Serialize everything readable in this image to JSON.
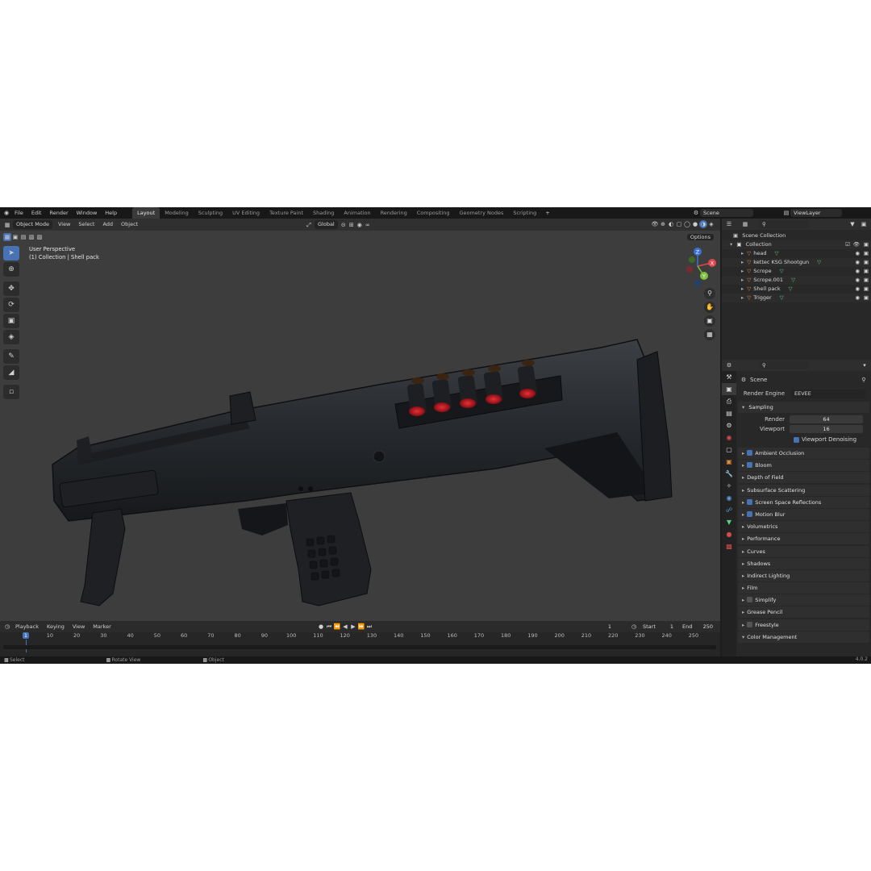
{
  "topbar": {
    "menus": [
      "File",
      "Edit",
      "Render",
      "Window",
      "Help"
    ],
    "workspaces": [
      "Layout",
      "Modeling",
      "Sculpting",
      "UV Editing",
      "Texture Paint",
      "Shading",
      "Animation",
      "Rendering",
      "Compositing",
      "Geometry Nodes",
      "Scripting"
    ],
    "active_workspace": "Layout",
    "add_tab": "+",
    "scene": "Scene",
    "view_layer": "ViewLayer"
  },
  "viewport_header": {
    "mode": "Object Mode",
    "menus": [
      "View",
      "Select",
      "Add",
      "Object"
    ],
    "orientation": "Global",
    "options": "Options"
  },
  "viewport": {
    "perspective": "User Perspective",
    "context": "(1) Collection | Shell pack",
    "gizmo_axes": [
      "Z",
      "Y",
      "X"
    ],
    "model_name": "kettec KSG Shootgun"
  },
  "timeline": {
    "menus": [
      "Playback",
      "Keying",
      "View",
      "Marker"
    ],
    "current_frame": "1",
    "start_label": "Start",
    "start": "1",
    "end_label": "End",
    "end": "250",
    "ticks": [
      "1",
      "10",
      "20",
      "30",
      "40",
      "50",
      "60",
      "70",
      "80",
      "90",
      "100",
      "110",
      "120",
      "130",
      "140",
      "150",
      "160",
      "170",
      "180",
      "190",
      "200",
      "210",
      "220",
      "230",
      "240",
      "250"
    ]
  },
  "status": {
    "items": [
      "Select",
      "Rotate View",
      "Object"
    ],
    "version": "4.0.2"
  },
  "outliner": {
    "scene_collection": "Scene Collection",
    "collection": "Collection",
    "objects": [
      "head",
      "kettec KSG Shootgun",
      "Scrope",
      "Scrope.001",
      "Shell pack",
      "Trigger"
    ]
  },
  "properties": {
    "scene": "Scene",
    "render_engine_label": "Render Engine",
    "render_engine": "EEVEE",
    "sampling": "Sampling",
    "render_label": "Render",
    "render_value": "64",
    "viewport_label": "Viewport",
    "viewport_value": "16",
    "viewport_denoising": "Viewport Denoising",
    "panels": [
      {
        "label": "Ambient Occlusion",
        "checkbox": "on"
      },
      {
        "label": "Bloom",
        "checkbox": "on"
      },
      {
        "label": "Depth of Field",
        "checkbox": "none"
      },
      {
        "label": "Subsurface Scattering",
        "checkbox": "none"
      },
      {
        "label": "Screen Space Reflections",
        "checkbox": "on"
      },
      {
        "label": "Motion Blur",
        "checkbox": "on"
      },
      {
        "label": "Volumetrics",
        "checkbox": "none"
      },
      {
        "label": "Performance",
        "checkbox": "none"
      },
      {
        "label": "Curves",
        "checkbox": "none"
      },
      {
        "label": "Shadows",
        "checkbox": "none"
      },
      {
        "label": "Indirect Lighting",
        "checkbox": "none"
      },
      {
        "label": "Film",
        "checkbox": "none"
      },
      {
        "label": "Simplify",
        "checkbox": "off"
      },
      {
        "label": "Grease Pencil",
        "checkbox": "none"
      },
      {
        "label": "Freestyle",
        "checkbox": "off"
      },
      {
        "label": "Color Management",
        "checkbox": "none"
      }
    ]
  },
  "colors": {
    "accent": "#4772b3",
    "shell_red": "#b3121a",
    "mesh_icon": "#e38a3a",
    "data_icon": "#5fc98a"
  }
}
